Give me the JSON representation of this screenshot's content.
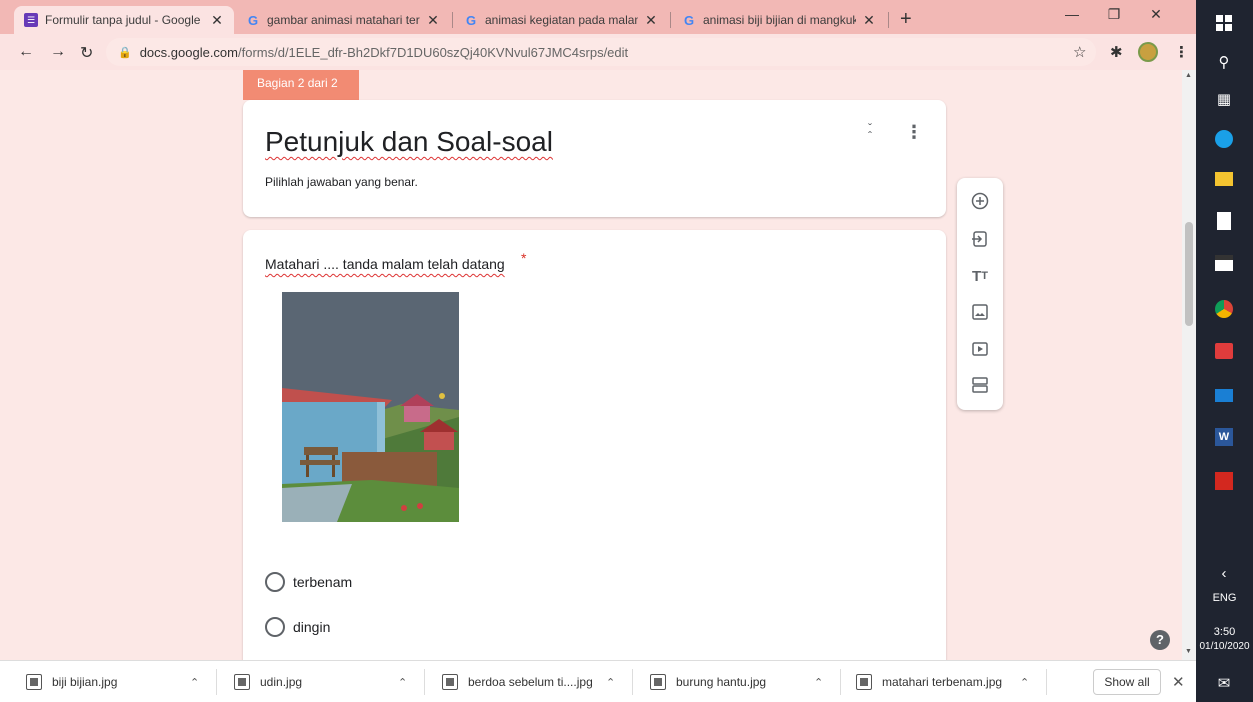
{
  "browser": {
    "tabs": [
      {
        "title": "Formulir tanpa judul - Google Fo",
        "icon": "forms-icon",
        "active": true
      },
      {
        "title": "gambar animasi matahari terben",
        "icon": "google-icon",
        "active": false
      },
      {
        "title": "animasi kegiatan pada malam ha",
        "icon": "google-icon",
        "active": false
      },
      {
        "title": "animasi biji bijian di mangkuk - G",
        "icon": "google-icon",
        "active": false
      }
    ],
    "url_host": "docs.google.com",
    "url_path": "/forms/d/1ELE_dfr-Bh2Dkf7D1DU60szQj40KVNvul67JMC4srps/edit"
  },
  "form": {
    "section_badge": "Bagian 2 dari 2",
    "section_title": "Petunjuk dan Soal-soal",
    "section_description": "Pilihlah jawaban yang benar.",
    "question": {
      "text": "Matahari .... tanda malam telah datang",
      "required_mark": "*",
      "options": [
        "terbenam",
        "dingin"
      ]
    }
  },
  "toolbar": {
    "tools": [
      "add-question-icon",
      "import-questions-icon",
      "add-title-icon",
      "add-image-icon",
      "add-video-icon",
      "add-section-icon"
    ]
  },
  "downloads": {
    "items": [
      "biji bijian.jpg",
      "udin.jpg",
      "berdoa sebelum ti....jpg",
      "burung hantu.jpg",
      "matahari terbenam.jpg"
    ],
    "show_all": "Show all"
  },
  "taskbar": {
    "lang": "ENG",
    "time": "3:50",
    "date": "01/10/2020"
  },
  "colors": {
    "theme_accent": "#f28b73",
    "page_bg": "#fce8e6",
    "tabstrip_bg": "#f2b8b5",
    "required": "#d93025"
  }
}
